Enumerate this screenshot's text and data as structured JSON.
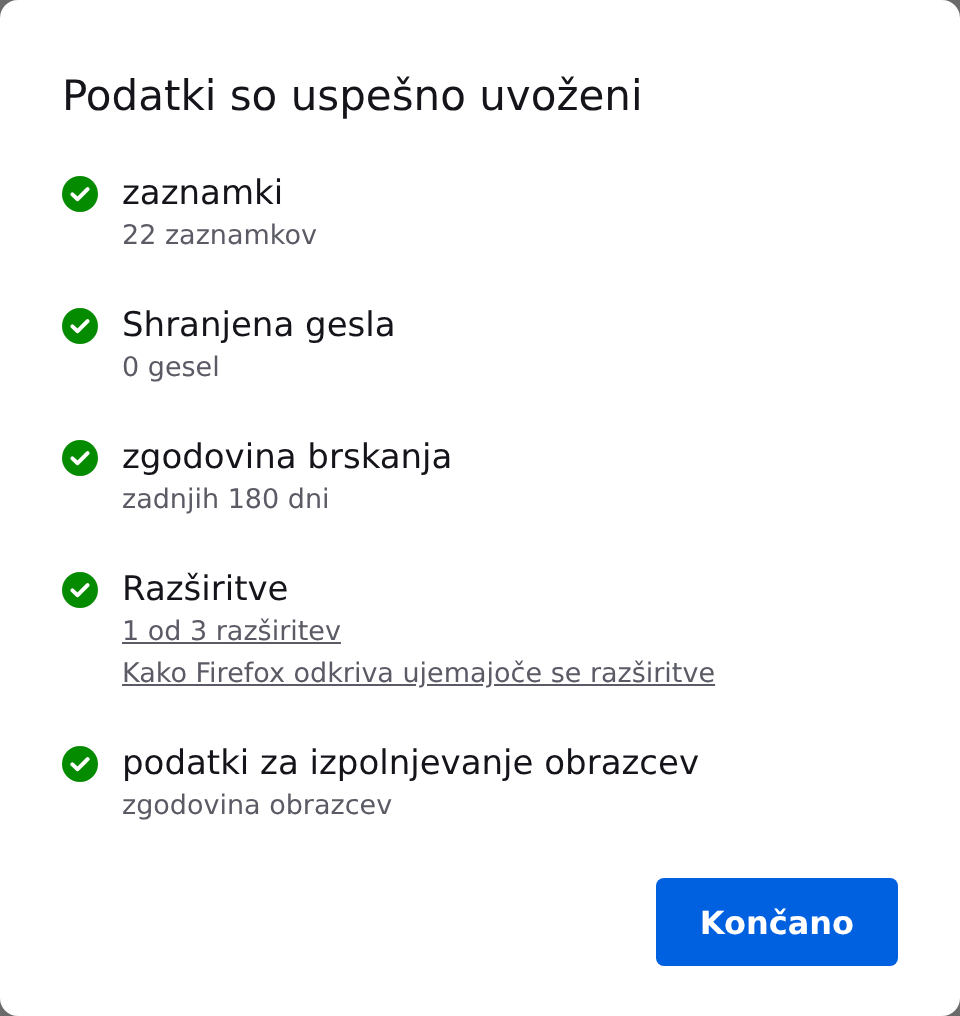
{
  "dialog": {
    "title": "Podatki so uspešno uvoženi"
  },
  "items": [
    {
      "label": "zaznamki",
      "done": true,
      "details": [
        {
          "kind": "text",
          "text": "22 zaznamkov"
        }
      ]
    },
    {
      "label": "Shranjena gesla",
      "done": true,
      "details": [
        {
          "kind": "text",
          "text": "0 gesel"
        }
      ]
    },
    {
      "label": "zgodovina brskanja",
      "done": true,
      "details": [
        {
          "kind": "text",
          "text": "zadnjih 180 dni"
        }
      ]
    },
    {
      "label": "Razširitve",
      "done": true,
      "details": [
        {
          "kind": "link",
          "text": "1 od 3 razširitev"
        },
        {
          "kind": "link",
          "text": "Kako Firefox odkriva ujemajoče se razširitve"
        }
      ]
    },
    {
      "label": "podatki za izpolnjevanje obrazcev",
      "done": true,
      "details": [
        {
          "kind": "text",
          "text": "zgodovina obrazcev"
        }
      ]
    }
  ],
  "buttons": [
    {
      "label": "Končano",
      "kind": "primary"
    }
  ]
}
